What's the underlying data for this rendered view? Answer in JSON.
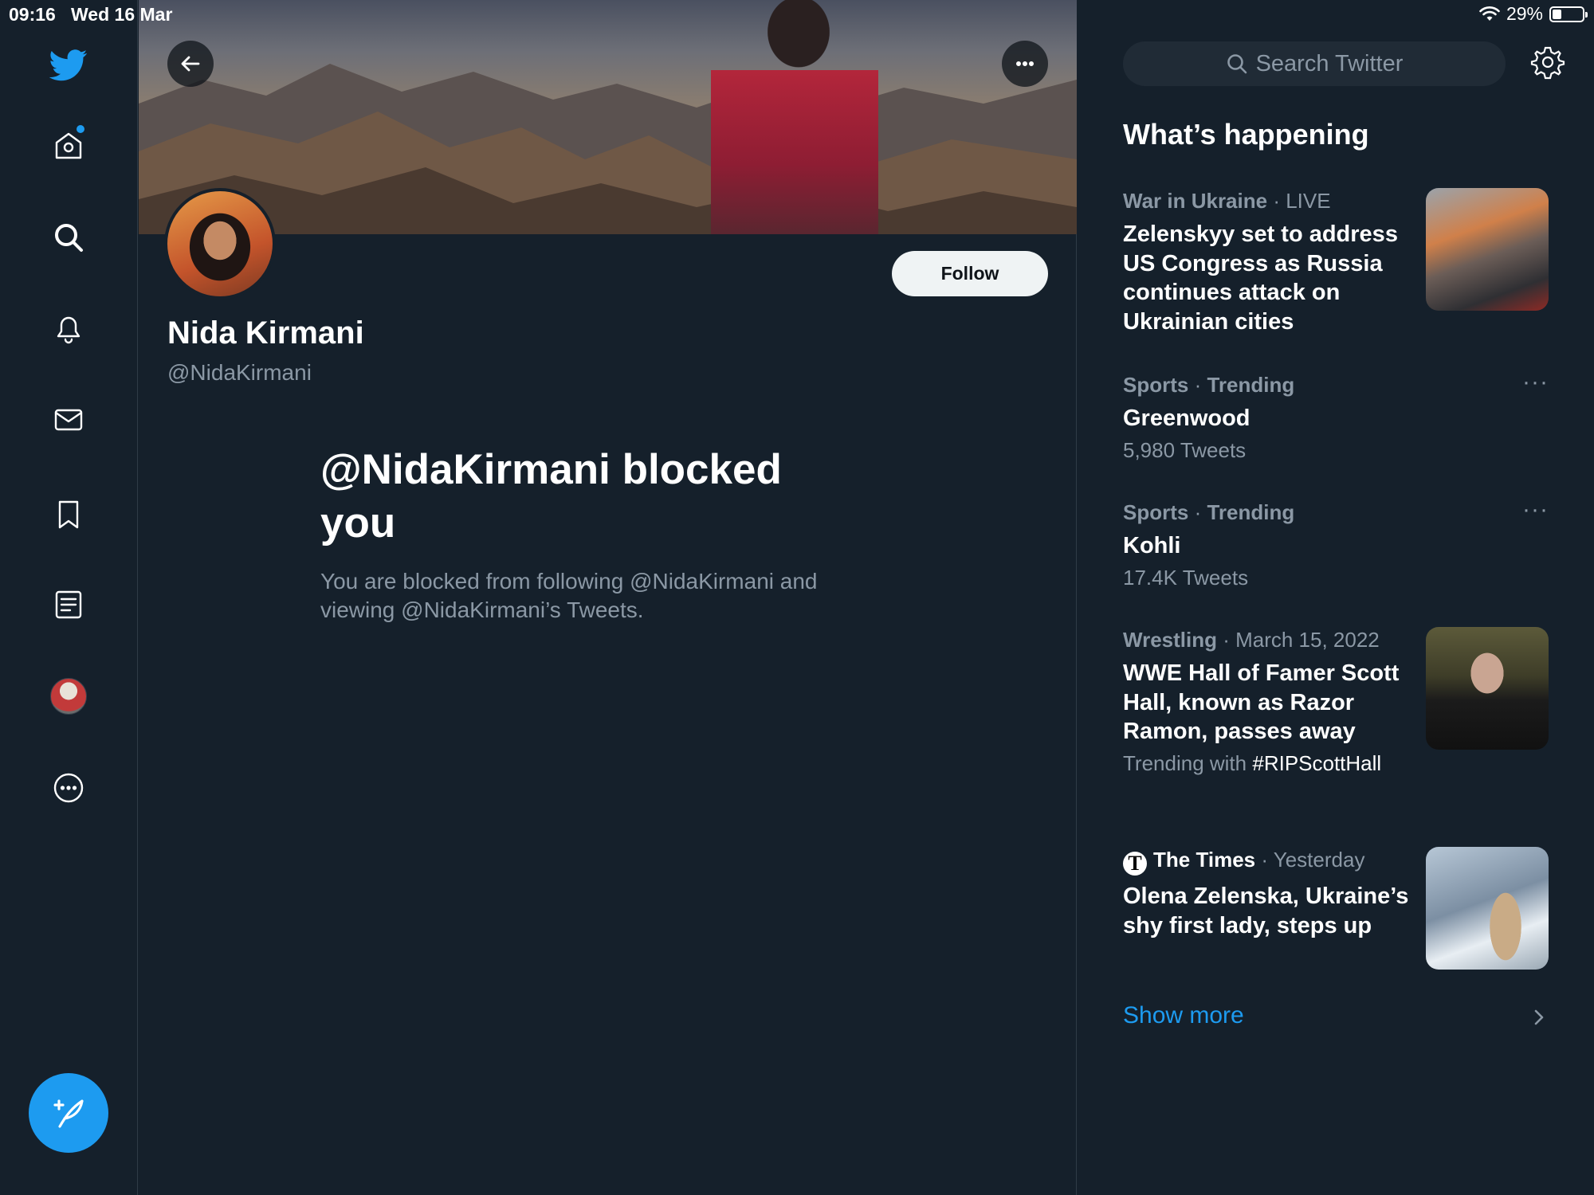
{
  "status_bar": {
    "time": "09:16",
    "date": "Wed 16 Mar",
    "battery": "29%",
    "battery_level": 0.29
  },
  "nav": {
    "items": [
      "twitter-logo",
      "home",
      "explore",
      "notifications",
      "messages",
      "bookmarks",
      "lists",
      "profile",
      "more"
    ],
    "has_notification_dot": true
  },
  "profile": {
    "name": "Nida Kirmani",
    "handle": "@NidaKirmani",
    "follow_label": "Follow",
    "blocked_title": "@NidaKirmani blocked you",
    "blocked_text": "You are blocked from following @NidaKirmani and viewing @NidaKirmani’s Tweets."
  },
  "sidebar": {
    "search_placeholder": "Search Twitter",
    "heading": "What’s happening",
    "trends": [
      {
        "category": "War in Ukraine",
        "context": "LIVE",
        "headline": "Zelenskyy set to address US Congress as Russia continues attack on Ukrainian cities"
      },
      {
        "category": "Sports",
        "context": "Trending",
        "headline": "Greenwood",
        "count": "5,980 Tweets"
      },
      {
        "category": "Sports",
        "context": "Trending",
        "headline": "Kohli",
        "count": "17.4K Tweets"
      },
      {
        "category": "Wrestling",
        "context": "March 15, 2022",
        "headline": "WWE Hall of Famer Scott Hall, known as Razor Ramon, passes away",
        "trending_prefix": "Trending with",
        "hashtag": "#RIPScottHall"
      },
      {
        "category": "The Times",
        "context": "Yesterday",
        "headline": "Olena Zelenska, Ukraine’s shy first lady, steps up"
      }
    ],
    "show_more": "Show more"
  },
  "colors": {
    "background": "#15202b",
    "accent": "#1d9bf0",
    "muted": "#8b98a5",
    "divider": "#2f3b47"
  }
}
